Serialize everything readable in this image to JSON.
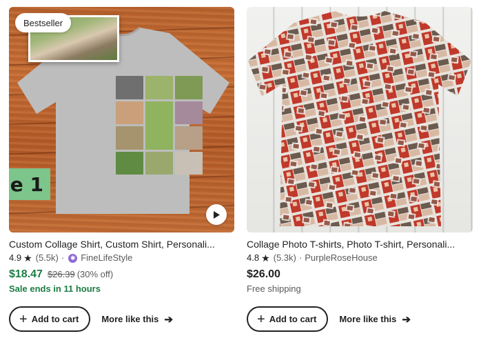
{
  "listings": [
    {
      "badge": "Bestseller",
      "title": "Custom Collage Shirt, Custom Shirt, Personali...",
      "rating": "4.9",
      "reviews": "(5.5k)",
      "shop": "FineLifeStyle",
      "price": "$18.47",
      "original_price": "$26.39",
      "discount": "(30% off)",
      "subline": "Sale ends in 11 hours",
      "image_tag": "e 1",
      "add_to_cart": "Add to cart",
      "more_like_this": "More like this"
    },
    {
      "title": "Collage Photo T-shirts, Photo T-shirt, Personali...",
      "rating": "4.8",
      "reviews": "(5.3k)",
      "shop": "PurpleRoseHouse",
      "price": "$26.00",
      "subline": "Free shipping",
      "add_to_cart": "Add to cart",
      "more_like_this": "More like this"
    }
  ],
  "icons": {
    "star": "star-icon",
    "plus": "plus-icon",
    "arrow": "arrow-right-icon",
    "play": "play-icon",
    "shop_badge": "star-seller-icon"
  },
  "colors": {
    "sale_green": "#1b7d43",
    "text": "#222222",
    "muted": "#595959",
    "star_seller": "#8e6bd6"
  }
}
